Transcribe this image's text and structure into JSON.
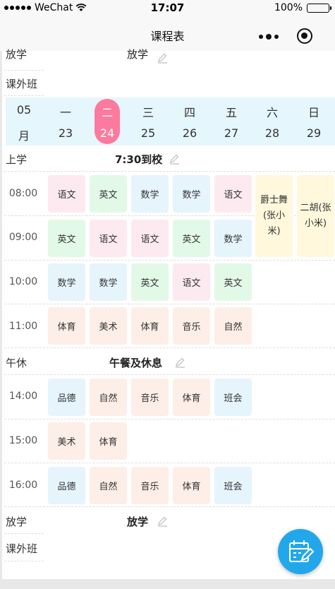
{
  "status_bar": {
    "carrier": "WeChat",
    "time": "17:07",
    "battery": "100%"
  },
  "nav": {
    "title": "课程表"
  },
  "top_partial": {
    "label": "放学",
    "note": "放学"
  },
  "extra_class_top": "课外班",
  "week": {
    "month_number": "05",
    "month_label": "月",
    "days": [
      {
        "weekday": "一",
        "date": "23"
      },
      {
        "weekday": "二",
        "date": "24"
      },
      {
        "weekday": "三",
        "date": "25"
      },
      {
        "weekday": "四",
        "date": "26"
      },
      {
        "weekday": "五",
        "date": "27"
      },
      {
        "weekday": "六",
        "date": "28"
      },
      {
        "weekday": "日",
        "date": "29"
      }
    ]
  },
  "arrive": {
    "label": "上学",
    "note": "7:30到校"
  },
  "morning": [
    {
      "time": "08:00",
      "classes": [
        "语文",
        "英文",
        "数学",
        "数学",
        "语文"
      ]
    },
    {
      "time": "09:00",
      "classes": [
        "英文",
        "语文",
        "语文",
        "英文",
        "数学"
      ]
    },
    {
      "time": "10:00",
      "classes": [
        "数学",
        "数学",
        "英文",
        "语文",
        "英文"
      ]
    },
    {
      "time": "11:00",
      "classes": [
        "体育",
        "美术",
        "体育",
        "音乐",
        "自然"
      ]
    }
  ],
  "weekend": {
    "saturday": "爵士舞(张小米)",
    "sunday": "二胡(张小米)"
  },
  "noon": {
    "label": "午休",
    "note": "午餐及休息"
  },
  "afternoon": [
    {
      "time": "14:00",
      "classes": [
        "品德",
        "自然",
        "音乐",
        "体育",
        "班会"
      ]
    },
    {
      "time": "15:00",
      "classes": [
        "美术",
        "体育"
      ]
    },
    {
      "time": "16:00",
      "classes": [
        "品德",
        "自然",
        "音乐",
        "体育",
        "班会"
      ]
    }
  ],
  "leave": {
    "label": "放学",
    "note": "放学"
  },
  "extra_class_bottom": "课外班",
  "colors": {
    "today": "#fb7a9e",
    "week_bg": "#e6f6fd",
    "fab": "#22a8ea"
  }
}
